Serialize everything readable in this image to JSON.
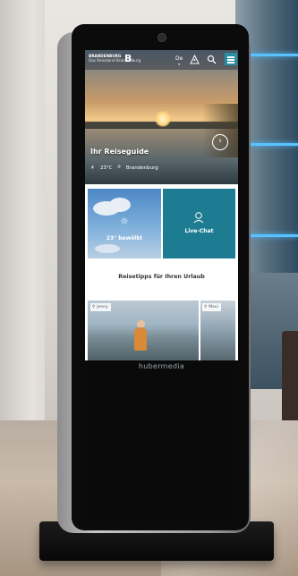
{
  "screen": {
    "header": {
      "logo_title": "BRANDENBURG",
      "logo_subtitle": "Das Reiseland Brandenburg",
      "logo_mark": "B",
      "language": "De",
      "icons": [
        "accessibility-icon",
        "search-icon",
        "menu-icon"
      ]
    },
    "hero": {
      "title": "Ihr Reiseguide",
      "temperature": "23°C",
      "location": "Brandenburg"
    },
    "tiles": {
      "weather": "23° bewölkt",
      "chat": "Live-Chat"
    },
    "tips": {
      "title": "Reisetipps für Ihren Urlaub",
      "cards": [
        {
          "author": "Jenny"
        },
        {
          "author": "Mavi"
        }
      ]
    }
  },
  "brand": "hubermedia"
}
